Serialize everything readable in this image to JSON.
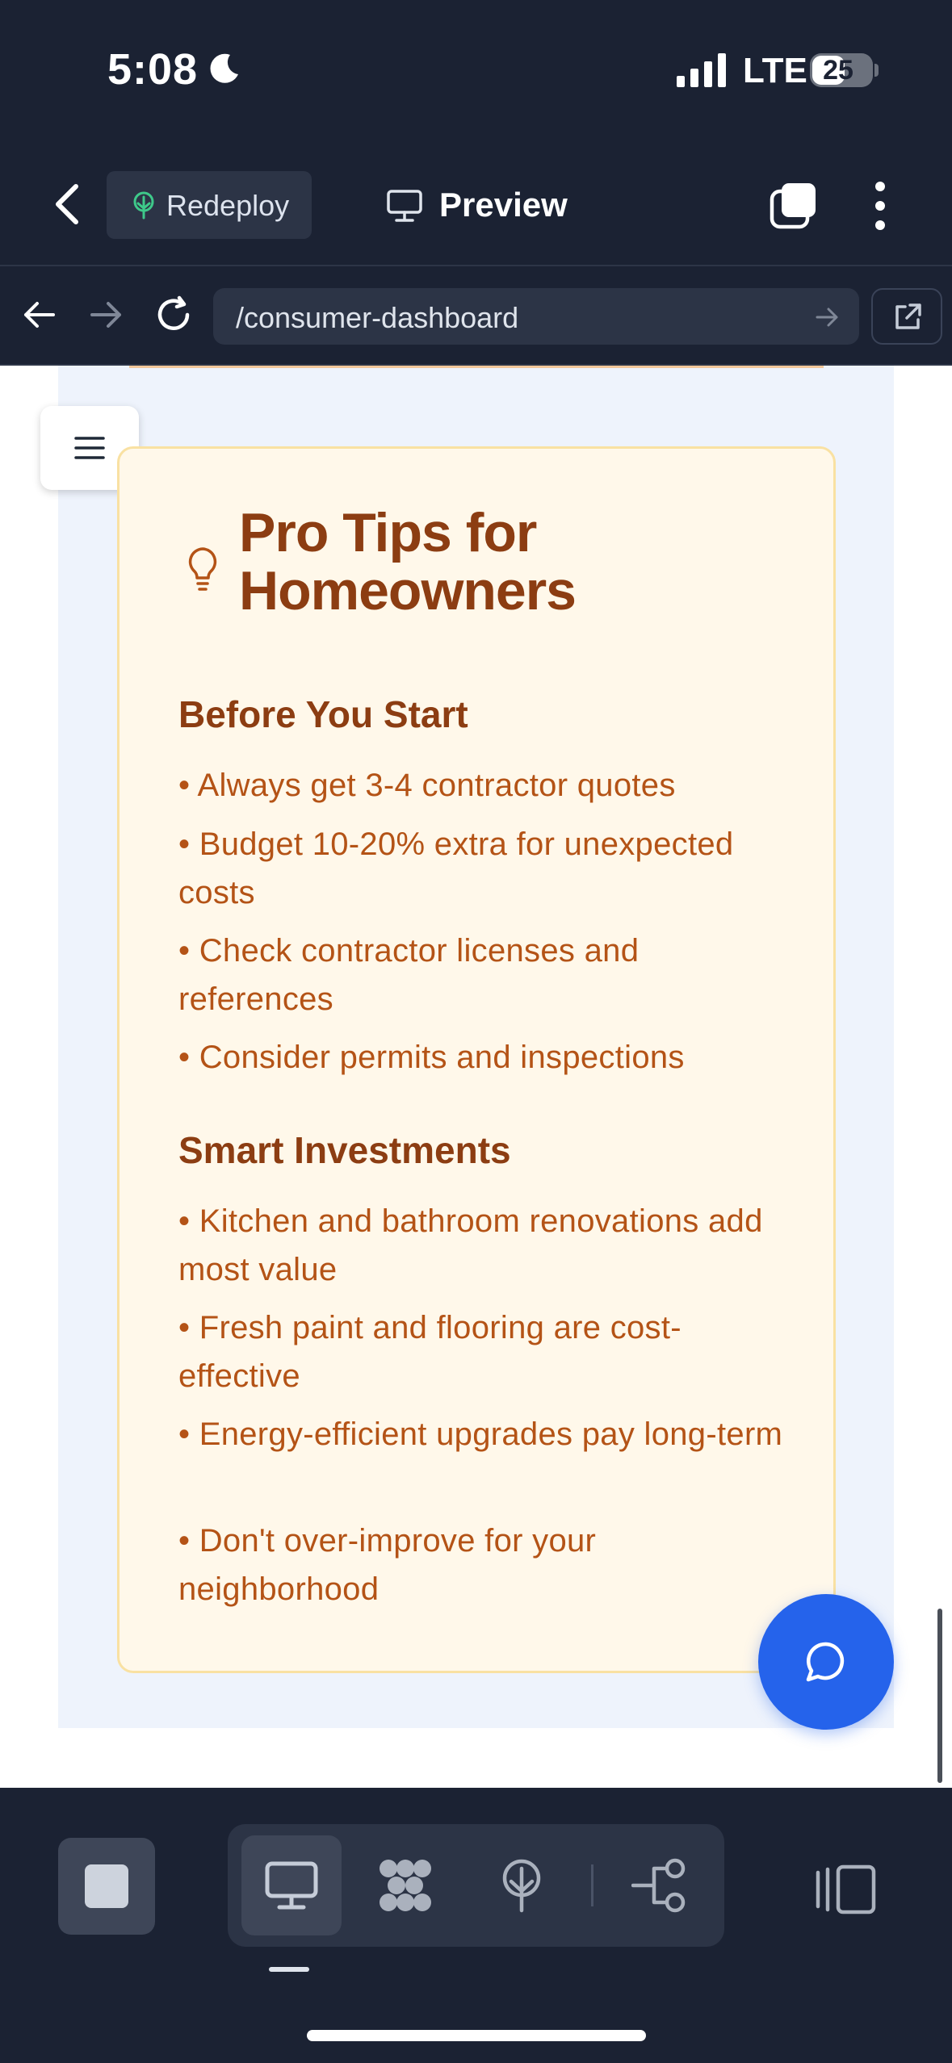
{
  "status_bar": {
    "time": "5:08",
    "network": "LTE",
    "battery": "25"
  },
  "toolbar": {
    "redeploy_label": "Redeploy",
    "preview_label": "Preview"
  },
  "url_bar": {
    "path": "/consumer-dashboard"
  },
  "tips": {
    "title": "Pro Tips for Homeowners",
    "sections": [
      {
        "heading": "Before You Start",
        "items": [
          "• Always get 3-4 contractor quotes",
          "• Budget 10-20% extra for unexpected costs",
          "• Check contractor licenses and references",
          "• Consider permits and inspections"
        ]
      },
      {
        "heading": "Smart Investments",
        "items": [
          "• Kitchen and bathroom renovations add most value",
          "• Fresh paint and flooring are cost-effective",
          "• Energy-efficient upgrades pay long-term",
          "• Don't over-improve for your neighborhood"
        ]
      }
    ]
  },
  "bottom_bar": {
    "active_view": "desktop-preview",
    "views": [
      "desktop-icon",
      "cluster-icon",
      "deploy-icon",
      "integrations-icon"
    ]
  },
  "colors": {
    "chrome_bg": "#1b2233",
    "card_bg": "#fff8ea",
    "heading_brown": "#8c3d12",
    "tip_orange": "#b45316",
    "accent_blue": "#2563eb"
  }
}
